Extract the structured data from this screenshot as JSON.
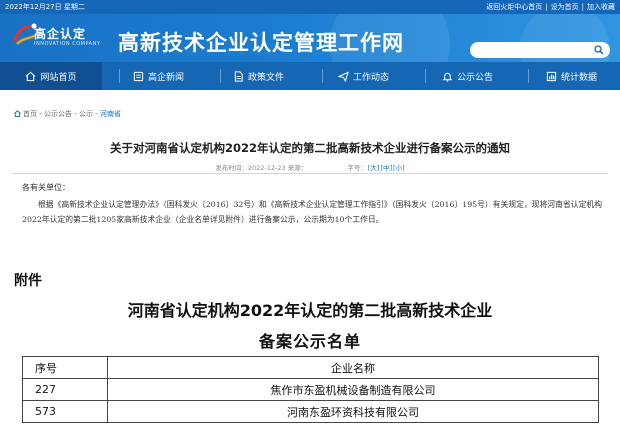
{
  "topbar": {
    "date": "2022年12月27日 星期二",
    "links": [
      "返回火炬中心首页",
      "设为首页",
      "加入收藏"
    ]
  },
  "logo": {
    "name": "高企认定",
    "subtitle": "INNOVATION COMPANY",
    "icon": "logo-swirl-icon"
  },
  "site_title": "高新技术企业认定管理工作网",
  "search": {
    "icon": "search-icon",
    "placeholder": ""
  },
  "nav": {
    "items": [
      {
        "label": "网站首页",
        "icon": "home-icon",
        "active": true
      },
      {
        "label": "高企新闻",
        "icon": "news-icon",
        "active": false
      },
      {
        "label": "政策文件",
        "icon": "document-icon",
        "active": false
      },
      {
        "label": "工作动态",
        "icon": "send-icon",
        "active": false
      },
      {
        "label": "公示公告",
        "icon": "bell-icon",
        "active": false
      },
      {
        "label": "统计数据",
        "icon": "chart-icon",
        "active": false
      }
    ]
  },
  "breadcrumb": {
    "icon": "home-icon",
    "items": [
      "首页",
      "公示公告",
      "公示",
      "河南省"
    ],
    "separator": " - "
  },
  "article": {
    "title": "关于对河南省认定机构2022年认定的第二批高新技术企业进行备案公示的通知",
    "meta_prefix": "发布时间：2022-12-23 来源：",
    "font_size_label": "字号：",
    "font_sizes": [
      "[大]",
      "[中]",
      "[小]"
    ],
    "salutation": "各有关单位：",
    "body": "根据《高新技术企业认定管理办法》（国科发火〔2016〕32号）和《高新技术企业认定管理工作指引》（国科发火〔2016〕195号）有关规定，现将河南省认定机构2022年认定的第二批1205家高新技术企业（企业名单详见附件）进行备案公示，公示期为10个工作日。"
  },
  "attachment": {
    "label": "附件",
    "title_line1": "河南省认定机构2022年认定的第二批高新技术企业",
    "title_line2": "备案公示名单",
    "table": {
      "headers": [
        "序号",
        "企业名称"
      ],
      "rows": [
        [
          "227",
          "焦作市东盈机械设备制造有限公司"
        ],
        [
          "573",
          "河南东盈环资科技有限公司"
        ]
      ]
    }
  },
  "colors": {
    "header_blue": "#1a72c4",
    "nav_blue": "#1567b3",
    "nav_active": "#0f4f92",
    "link_blue": "#1466b8"
  }
}
